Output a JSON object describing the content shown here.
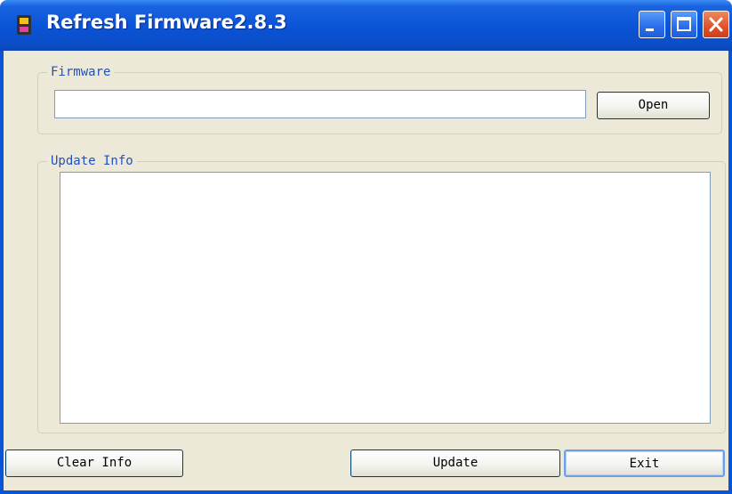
{
  "window": {
    "title": "Refresh Firmware2.8.3",
    "icon": "app-device-icon",
    "controls": [
      "minimize-icon",
      "maximize-icon",
      "close-icon"
    ]
  },
  "firmware_group": {
    "label": "Firmware",
    "path_value": "",
    "open_label": "Open"
  },
  "update_info_group": {
    "label": "Update Info",
    "text": ""
  },
  "buttons": {
    "clear_info": "Clear Info",
    "update": "Update",
    "exit": "Exit"
  },
  "colors": {
    "titlebar": "#0a54d8",
    "dialog_bg": "#ece9d8",
    "group_label": "#2150c0",
    "close_button": "#e0502a"
  }
}
